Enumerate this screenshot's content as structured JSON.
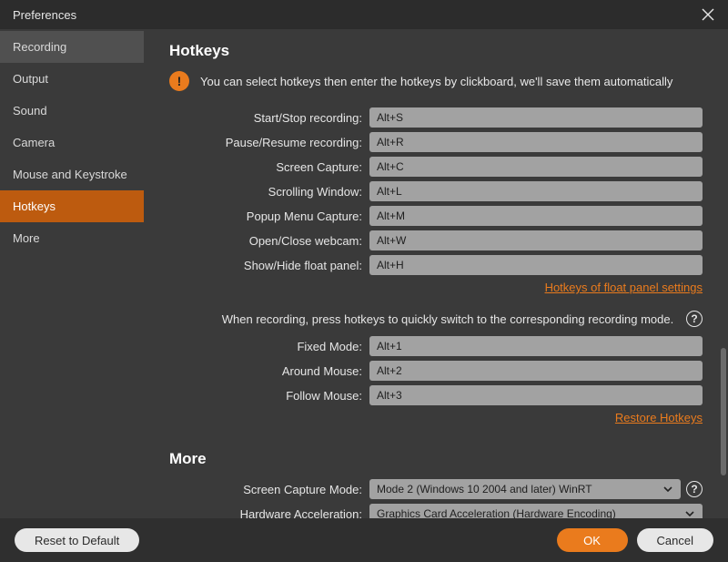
{
  "titlebar": {
    "title": "Preferences"
  },
  "sidebar": {
    "items": [
      {
        "label": "Recording"
      },
      {
        "label": "Output"
      },
      {
        "label": "Sound"
      },
      {
        "label": "Camera"
      },
      {
        "label": "Mouse and Keystroke"
      },
      {
        "label": "Hotkeys"
      },
      {
        "label": "More"
      }
    ]
  },
  "hotkeys": {
    "heading": "Hotkeys",
    "note": "You can select hotkeys then enter the hotkeys by clickboard, we'll save them automatically",
    "rows": [
      {
        "label": "Start/Stop recording:",
        "value": "Alt+S"
      },
      {
        "label": "Pause/Resume recording:",
        "value": "Alt+R"
      },
      {
        "label": "Screen Capture:",
        "value": "Alt+C"
      },
      {
        "label": "Scrolling Window:",
        "value": "Alt+L"
      },
      {
        "label": "Popup Menu Capture:",
        "value": "Alt+M"
      },
      {
        "label": "Open/Close webcam:",
        "value": "Alt+W"
      },
      {
        "label": "Show/Hide float panel:",
        "value": "Alt+H"
      }
    ],
    "float_link": "Hotkeys of float panel settings",
    "mode_note": "When recording, press hotkeys to quickly switch to the corresponding recording mode.",
    "modes": [
      {
        "label": "Fixed Mode:",
        "value": "Alt+1"
      },
      {
        "label": "Around Mouse:",
        "value": "Alt+2"
      },
      {
        "label": "Follow Mouse:",
        "value": "Alt+3"
      }
    ],
    "restore_link": "Restore Hotkeys"
  },
  "more": {
    "heading": "More",
    "capture_mode": {
      "label": "Screen Capture Mode:",
      "value": "Mode 2 (Windows 10 2004 and later) WinRT"
    },
    "hw_accel": {
      "label": "Hardware Acceleration:",
      "value": "Graphics Card Acceleration (Hardware Encoding)"
    }
  },
  "footer": {
    "reset": "Reset to Default",
    "ok": "OK",
    "cancel": "Cancel"
  },
  "icons": {
    "help": "?",
    "badge": "!"
  }
}
